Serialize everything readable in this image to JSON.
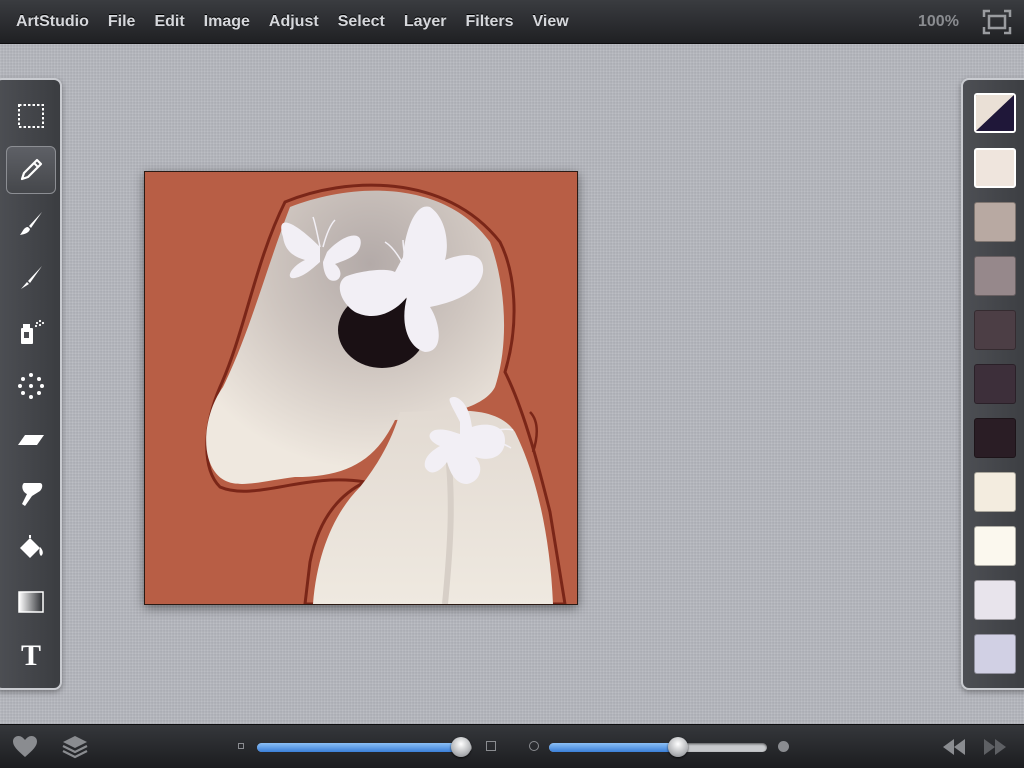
{
  "app": {
    "menu": [
      "ArtStudio",
      "File",
      "Edit",
      "Image",
      "Adjust",
      "Select",
      "Layer",
      "Filters",
      "View"
    ],
    "zoom": "100%"
  },
  "toolbar": {
    "tools": [
      {
        "name": "selection-tool",
        "icon": "dotted-rectangle-icon"
      },
      {
        "name": "pencil-tool",
        "icon": "pencil-icon",
        "active": true
      },
      {
        "name": "brush-tool",
        "icon": "brush-icon"
      },
      {
        "name": "paint-brush-tool",
        "icon": "fine-brush-icon"
      },
      {
        "name": "spray-tool",
        "icon": "spray-can-icon"
      },
      {
        "name": "scatter-tool",
        "icon": "dots-icon"
      },
      {
        "name": "eraser-tool",
        "icon": "eraser-icon"
      },
      {
        "name": "smudge-tool",
        "icon": "smudge-icon"
      },
      {
        "name": "fill-tool",
        "icon": "paint-bucket-icon"
      },
      {
        "name": "gradient-tool",
        "icon": "gradient-icon"
      },
      {
        "name": "text-tool",
        "icon": "text-icon",
        "glyph": "T"
      }
    ]
  },
  "palette": {
    "current": {
      "primary": "#eae0d6",
      "secondary": "#1f1739"
    },
    "swatches": [
      "#efe5dd",
      "#b8a9a2",
      "#96888b",
      "#4c3e45",
      "#3d2f3a",
      "#2a1d25",
      "#f3ecdf",
      "#fbf8ee",
      "#e8e4ec",
      "#d1d0e4"
    ],
    "selected_index": 0
  },
  "canvas": {
    "background": "#b85e45",
    "figure": "#ece4da"
  },
  "bottom": {
    "size_slider": 0.95,
    "opacity_slider": 0.59
  }
}
